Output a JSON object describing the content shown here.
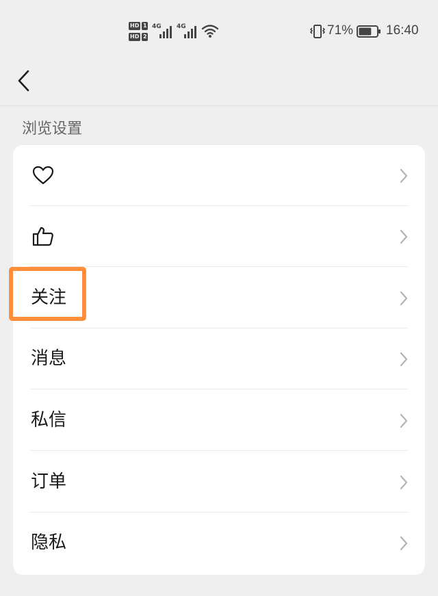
{
  "status_bar": {
    "sim1_badge": "HD",
    "sim1_slot": "1",
    "sim2_badge": "HD",
    "sim2_slot": "2",
    "network1": "4G",
    "network2": "4G",
    "battery_percent": "71%",
    "battery_level": 0.71,
    "time": "16:40",
    "icons": [
      "signal-icon",
      "wifi-icon",
      "vibrate-icon",
      "battery-icon"
    ]
  },
  "nav": {
    "back_icon": "back-arrow-icon"
  },
  "section": {
    "title": "浏览设置"
  },
  "rows": [
    {
      "icon": "heart-icon",
      "label": ""
    },
    {
      "icon": "thumbs-up-icon",
      "label": ""
    },
    {
      "icon": "",
      "label": "关注"
    },
    {
      "icon": "",
      "label": "消息"
    },
    {
      "icon": "",
      "label": "私信"
    },
    {
      "icon": "",
      "label": "订单"
    },
    {
      "icon": "",
      "label": "隐私"
    }
  ],
  "colors": {
    "background": "#efefef",
    "card": "#ffffff",
    "highlight": "#ff8f3a",
    "text": "#1a1a1a",
    "secondary_text": "#666666",
    "chevron": "#b3b3b3"
  }
}
